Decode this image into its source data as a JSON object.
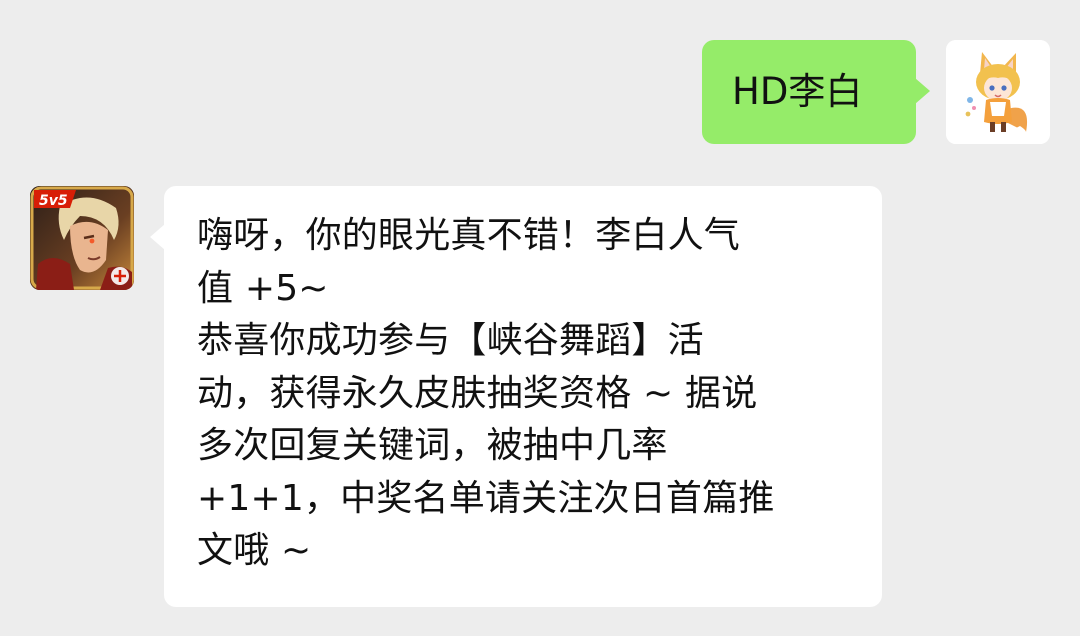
{
  "chat": {
    "outgoing": {
      "text": "HD李白",
      "bubble_color": "#95ec69"
    },
    "incoming": {
      "lines": [
        "嗨呀，你的眼光真不错！李白人气",
        "值 +5~",
        "恭喜你成功参与【峡谷舞蹈】活",
        "动，获得永久皮肤抽奖资格 ~ 据说",
        "多次回复关键词，被抽中几率",
        "+1+1，中奖名单请关注次日首篇推",
        "文哦 ~"
      ],
      "bubble_color": "#ffffff"
    },
    "user_avatar": {
      "icon": "fox-girl-avatar-icon"
    },
    "bot_avatar": {
      "icon": "game-app-avatar-icon",
      "badge_text": "5v5"
    }
  },
  "colors": {
    "background": "#ededed",
    "badge_red": "#d81e06"
  }
}
